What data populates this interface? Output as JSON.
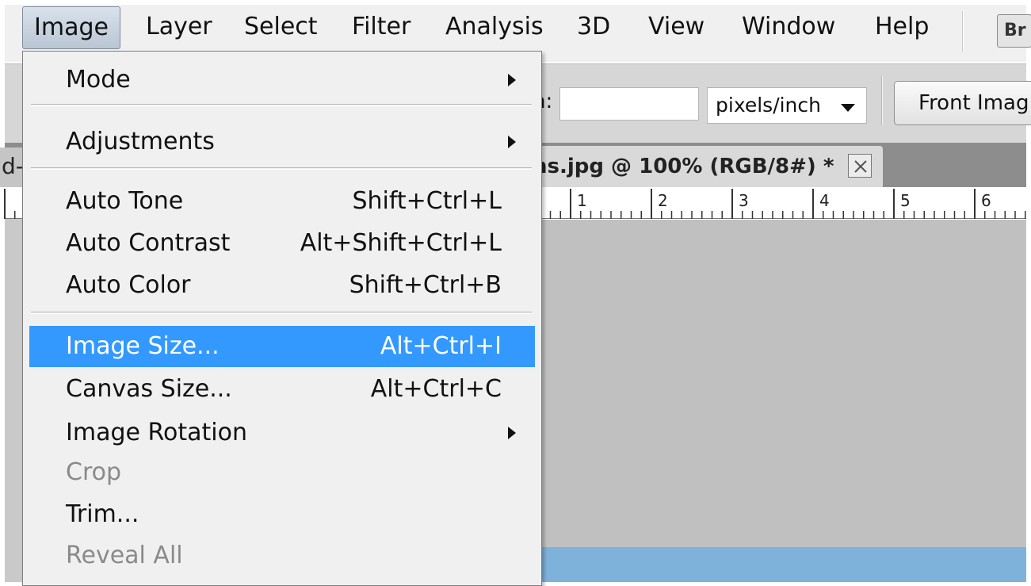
{
  "menubar": {
    "items": [
      {
        "label": "Image",
        "active": true
      },
      {
        "label": "Layer"
      },
      {
        "label": "Select"
      },
      {
        "label": "Filter"
      },
      {
        "label": "Analysis"
      },
      {
        "label": "3D"
      },
      {
        "label": "View"
      },
      {
        "label": "Window"
      },
      {
        "label": "Help"
      }
    ],
    "br_button_label": "Br"
  },
  "options_bar": {
    "field_label": "n:",
    "field_value": "",
    "unit_select": "pixels/inch",
    "front_image_button": "Front Imag"
  },
  "document": {
    "inactive_tab": "d-",
    "tab_title": "ns.jpg @ 100% (RGB/8#) *"
  },
  "ruler": {
    "numbers": [
      "1",
      "2",
      "3",
      "4",
      "5",
      "6"
    ]
  },
  "image_menu": {
    "items": [
      {
        "label": "Mode",
        "submenu": true
      },
      {
        "label": "Adjustments",
        "submenu": true
      },
      {
        "label": "Auto Tone",
        "shortcut": "Shift+Ctrl+L"
      },
      {
        "label": "Auto Contrast",
        "shortcut": "Alt+Shift+Ctrl+L"
      },
      {
        "label": "Auto Color",
        "shortcut": "Shift+Ctrl+B"
      },
      {
        "label": "Image Size...",
        "shortcut": "Alt+Ctrl+I",
        "highlighted": true
      },
      {
        "label": "Canvas Size...",
        "shortcut": "Alt+Ctrl+C"
      },
      {
        "label": "Image Rotation",
        "submenu": true
      },
      {
        "label": "Crop",
        "disabled": true
      },
      {
        "label": "Trim..."
      },
      {
        "label": "Reveal All",
        "disabled": true
      }
    ]
  },
  "colors": {
    "menu_highlight": "#3399ff",
    "menu_background": "#f0f0f0",
    "canvas_gray": "#c0c0c0",
    "image_blue": "#7fb2db"
  }
}
